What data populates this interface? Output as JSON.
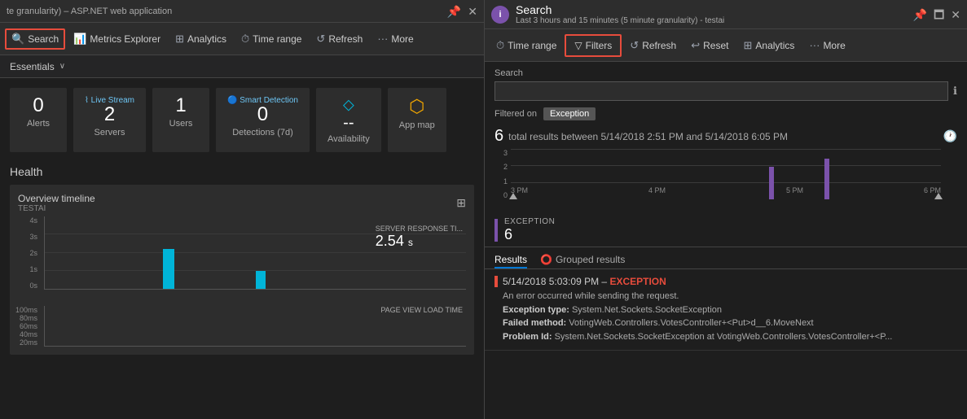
{
  "leftPanel": {
    "titleBar": {
      "text": "te granularity) – ASP.NET web application"
    },
    "toolbar": {
      "searchLabel": "Search",
      "metricsExplorerLabel": "Metrics Explorer",
      "analyticsLabel": "Analytics",
      "timeRangeLabel": "Time range",
      "refreshLabel": "Refresh",
      "moreLabel": "More"
    },
    "essentials": {
      "label": "Essentials"
    },
    "metrics": [
      {
        "value": "0",
        "label": "Alerts"
      },
      {
        "value": "2",
        "sublabel": "Live Stream",
        "label": "Servers"
      },
      {
        "value": "1",
        "label": "Users"
      },
      {
        "value": "0",
        "sublabel": "Smart Detection",
        "label": "Detections (7d)"
      },
      {
        "value": "--",
        "label": "Availability"
      },
      {
        "value": "",
        "label": "App map"
      }
    ],
    "health": {
      "title": "Health",
      "overviewTitle": "Overview timeline",
      "overviewSubtitle": "TESTAI",
      "yLabels": [
        "4s",
        "3s",
        "2s",
        "1s",
        "0s"
      ],
      "yLabels2": [
        "100ms",
        "80ms",
        "60ms",
        "40ms",
        "20ms"
      ],
      "serverResponseTitle": "SERVER RESPONSE TI...",
      "serverResponseValue": "2.54",
      "serverResponseUnit": "s",
      "pageViewTitle": "PAGE VIEW LOAD TIME"
    }
  },
  "rightPanel": {
    "titleBar": {
      "icon": "i",
      "mainTitle": "Search",
      "subtitle": "Last 3 hours and 15 minutes (5 minute granularity) - testai"
    },
    "toolbar": {
      "timeRangeLabel": "Time range",
      "filtersLabel": "Filters",
      "refreshLabel": "Refresh",
      "resetLabel": "Reset",
      "analyticsLabel": "Analytics",
      "moreLabel": "More"
    },
    "search": {
      "label": "Search",
      "placeholder": ""
    },
    "filteredOn": {
      "label": "Filtered on",
      "tag": "Exception"
    },
    "results": {
      "count": "6",
      "text": "total results between 5/14/2018 2:51 PM and 5/14/2018 6:05 PM"
    },
    "chart": {
      "yLabels": [
        "3",
        "2",
        "1",
        "0"
      ],
      "xLabels": [
        "3 PM",
        "4 PM",
        "5 PM",
        "6 PM"
      ],
      "bars": [
        {
          "position": 60,
          "height": 60
        },
        {
          "position": 72,
          "height": 75
        }
      ]
    },
    "exception": {
      "typeLabel": "EXCEPTION",
      "count": "6"
    },
    "tabs": [
      {
        "label": "Results",
        "active": true,
        "icon": false
      },
      {
        "label": "Grouped results",
        "active": false,
        "icon": true
      }
    ],
    "result": {
      "timestamp": "5/14/2018 5:03:09 PM – EXCEPTION",
      "line1": "An error occurred while sending the request.",
      "line2key": "Exception type: ",
      "line2val": "System.Net.Sockets.SocketException",
      "line3key": "Failed method: ",
      "line3val": "VotingWeb.Controllers.VotesController+<Put>d__6.MoveNext",
      "line4key": "Problem Id: ",
      "line4val": "System.Net.Sockets.SocketException at VotingWeb.Controllers.VotesController+<P..."
    }
  }
}
